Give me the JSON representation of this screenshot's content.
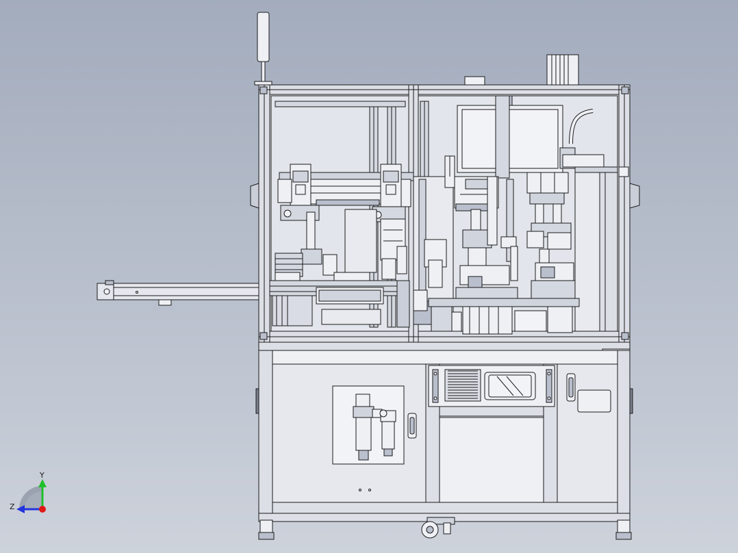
{
  "viewport": {
    "background_top": "#a3acbd",
    "background_bottom": "#cdd2db"
  },
  "model": {
    "line_color": "#1a1a1a",
    "frame_fill": "#eef0f4",
    "panel_fill": "#e6e8ee",
    "shade_fill": "#b9bfcc",
    "dark_fill": "#7a808c"
  },
  "triad": {
    "y_label": "Y",
    "z_label": "Z",
    "y_color": "#1fbf2a",
    "z_color": "#2233dd",
    "x_color": "#e01818",
    "icons": [
      "axis-triad-icon"
    ]
  }
}
